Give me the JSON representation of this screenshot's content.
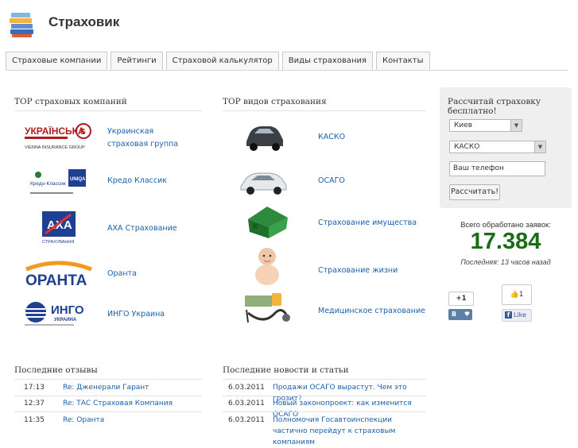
{
  "site": {
    "title": "Страховик"
  },
  "tabs": [
    "Страховые компании",
    "Рейтинги",
    "Страховой калькулятор",
    "Виды страхования",
    "Контакты"
  ],
  "companies": {
    "title": "TOP страховых компаний",
    "items": [
      {
        "name": "Украинская страховая группа",
        "logo_text": "УКРАЇНСЬКА",
        "logo_sub": "VIENNA INSURANCE GROUP"
      },
      {
        "name": "Кредо Классик",
        "logo_text": "Кредо-Классик",
        "logo_sub": "UNIQA"
      },
      {
        "name": "AXA Страхование",
        "logo_text": "AXA",
        "logo_sub": "СТРАХУВАННЯ"
      },
      {
        "name": "Оранта",
        "logo_text": "ОРАНТА"
      },
      {
        "name": "ИНГО Украина",
        "logo_text": "ИНГО",
        "logo_sub": "УКРАИНА"
      }
    ]
  },
  "insurance_types": {
    "title": "TOP видов страхования",
    "items": [
      {
        "name": "КАСКО",
        "icon": "car-icon"
      },
      {
        "name": "ОСАГО",
        "icon": "car-icon"
      },
      {
        "name": "Страхование имущества",
        "icon": "house-icon"
      },
      {
        "name": "Страхование жизни",
        "icon": "baby-icon"
      },
      {
        "name": "Медицинское страхование",
        "icon": "stethoscope-icon"
      }
    ]
  },
  "calculator": {
    "title": "Рассчитай страховку бесплатно!",
    "city": "Киев",
    "type": "КАСКО",
    "phone_placeholder": "Ваш телефон",
    "button": "Рассчитать!"
  },
  "stats": {
    "label": "Всего обработано заявок:",
    "count": "17.384",
    "last": "Последняя: 13 часов назад"
  },
  "social": {
    "gplus": "+1",
    "vk": "В",
    "like_count": "1",
    "fb": "Like"
  },
  "reviews": {
    "title": "Последние отзывы",
    "items": [
      {
        "time": "17:13",
        "text": "Re: Дженерали Гарант"
      },
      {
        "time": "12:37",
        "text": "Re: ТАС Страховая Компания"
      },
      {
        "time": "11:35",
        "text": "Re: Оранта"
      }
    ]
  },
  "news": {
    "title": "Последние новости и статьи",
    "items": [
      {
        "date": "6.03.2011",
        "text": "Продажи ОСАГО вырастут. Чем это грозит?"
      },
      {
        "date": "6.03.2011",
        "text": "Новый законопроект: как изменится ОСАГО"
      },
      {
        "date": "6.03.2011",
        "text": "Полномочия Госавтоинспекции частично перейдут к страховым компаниям"
      }
    ]
  },
  "colors": {
    "link": "#1a5fa8",
    "counter": "#1d6b16",
    "orange": "#f39a1e",
    "axa_blue": "#1f3f93"
  }
}
